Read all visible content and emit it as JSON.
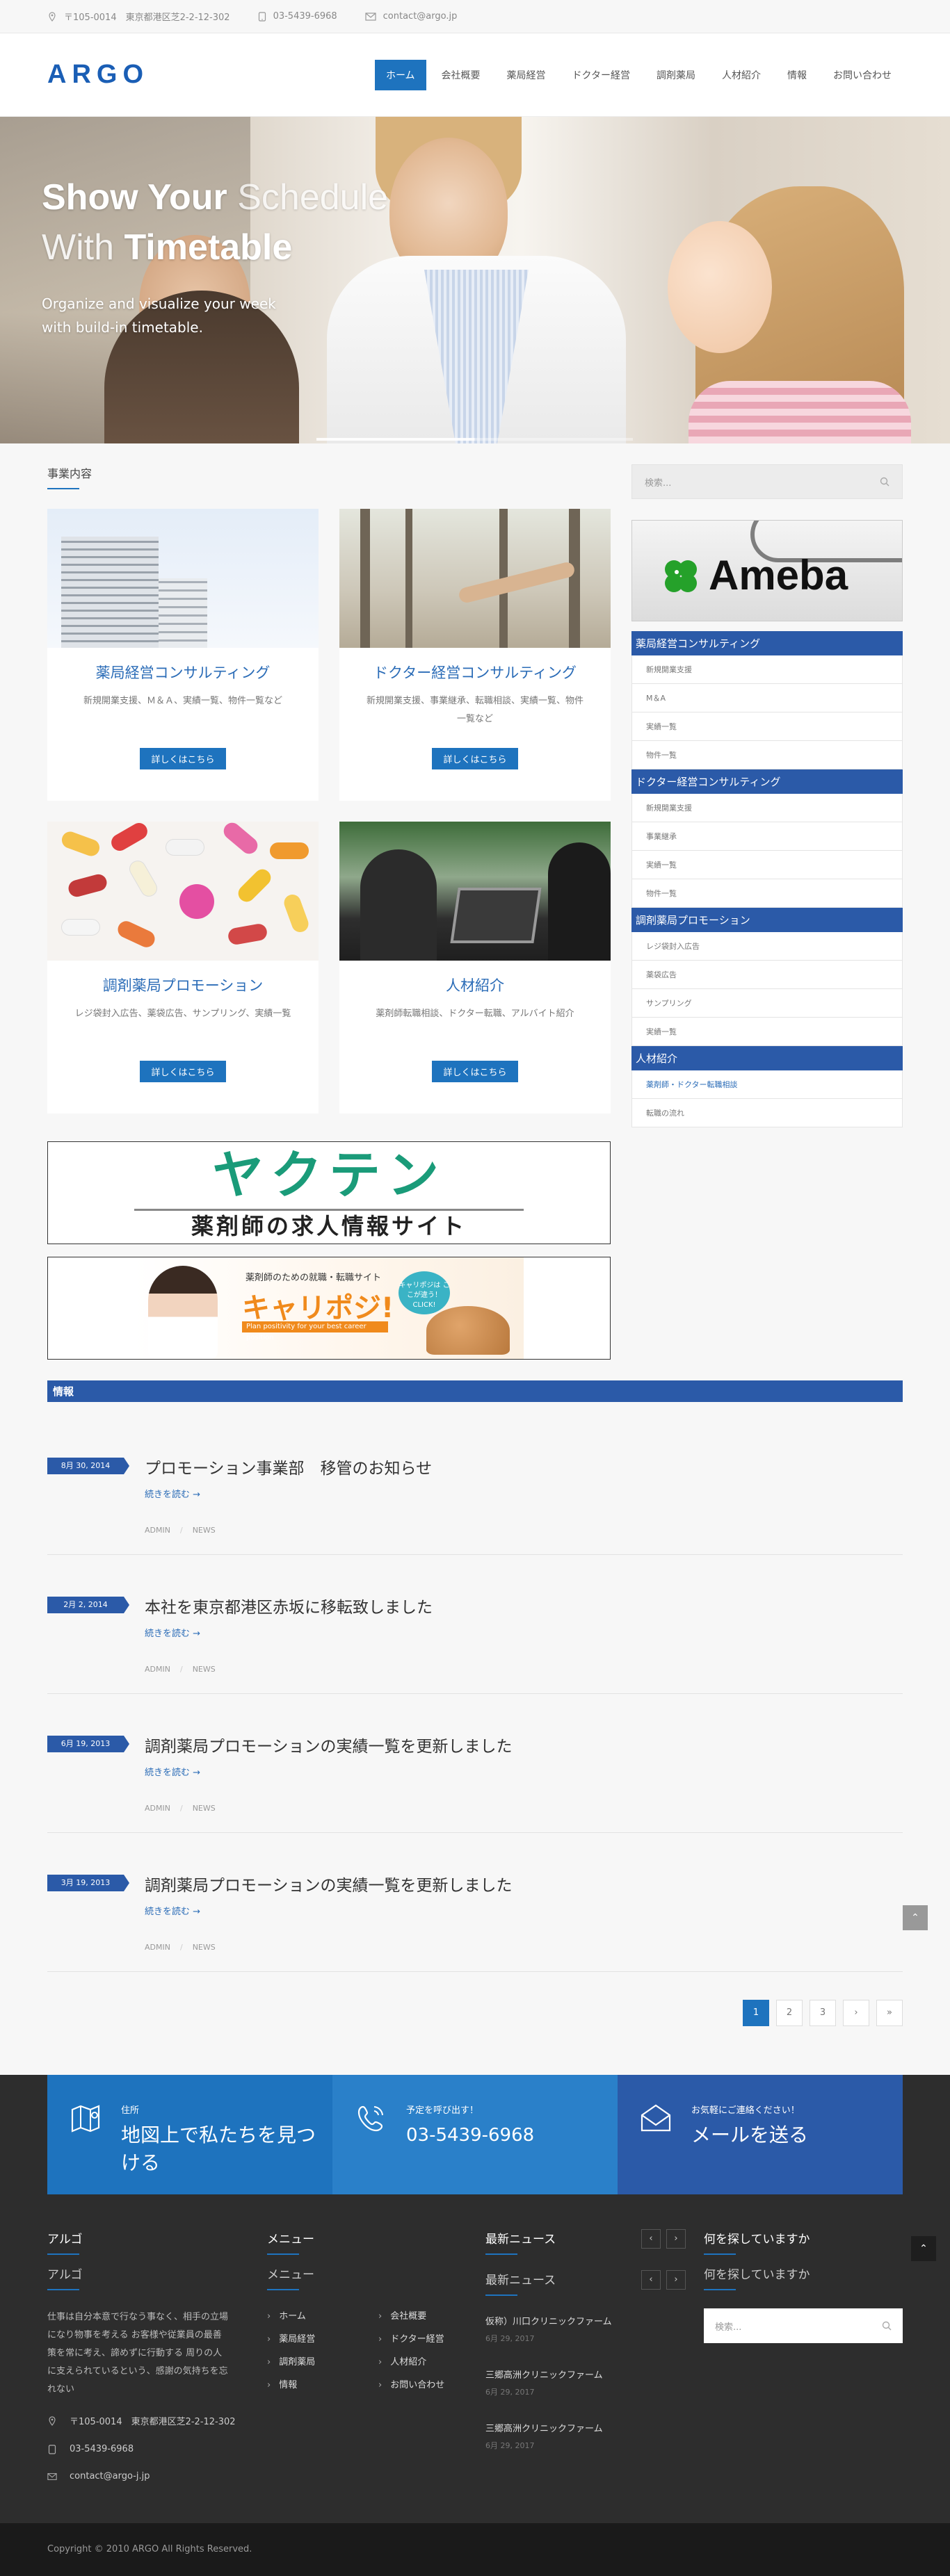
{
  "topbar": {
    "address": "〒105-0014　東京都港区芝2-2-12-302",
    "phone": "03-5439-6968",
    "email": "contact@argo.jp"
  },
  "header": {
    "logo": "ARGO",
    "nav": [
      "ホーム",
      "会社概要",
      "薬局経営",
      "ドクター経営",
      "調剤薬局",
      "人材紹介",
      "情報",
      "お問い合わせ"
    ]
  },
  "hero": {
    "line1_bold": "Show Your",
    "line1_light": " Schedule",
    "line2_light": "With ",
    "line2_bold": "Timetable",
    "sub1": "Organize and visualize your week",
    "sub2": "with build-in timetable.",
    "progress": 0.5
  },
  "business": {
    "title": "事業内容",
    "cards": [
      {
        "title": "薬局経営コンサルティング",
        "desc": "新規開業支援、Ｍ＆Ａ、実績一覧、物件一覧など",
        "button": "詳しくはこちら"
      },
      {
        "title": "ドクター経営コンサルティング",
        "desc": "新規開業支援、事業継承、転職相談、実績一覧、物件一覧など",
        "button": "詳しくはこちら"
      },
      {
        "title": "調剤薬局プロモーション",
        "desc": "レジ袋封入広告、薬袋広告、サンプリング、実績一覧",
        "button": "詳しくはこちら"
      },
      {
        "title": "人材紹介",
        "desc": "薬剤師転職相談、ドクター転職、アルバイト紹介",
        "button": "詳しくはこちら"
      }
    ]
  },
  "banners": {
    "yakuten_big": "ヤクテン",
    "yakuten_small": "薬剤師の求人情報サイト",
    "caripoji_tag": "薬剤師のための就職・転職サイト",
    "caripoji_logo": "キャリポジ!",
    "caripoji_bar": "Plan positivity for your best career position",
    "caripoji_bubble": "キャリポジは ここが違う！ CLICK!"
  },
  "sidebar": {
    "search_placeholder": "検索...",
    "ameba": "Ameba",
    "groups": [
      {
        "title": "薬局経営コンサルティング",
        "items": [
          "新規開業支援",
          "M＆A",
          "実績一覧",
          "物件一覧"
        ]
      },
      {
        "title": "ドクター経営コンサルティング",
        "items": [
          "新規開業支援",
          "事業継承",
          "実績一覧",
          "物件一覧"
        ]
      },
      {
        "title": "調剤薬局プロモーション",
        "items": [
          "レジ袋封入広告",
          "薬袋広告",
          "サンプリング",
          "実績一覧"
        ]
      },
      {
        "title": "人材紹介",
        "items": [
          "薬剤師・ドクター転職相談",
          "転職の流れ"
        ]
      }
    ]
  },
  "info": {
    "title": "情報",
    "read_more": "続きを読む →",
    "posts": [
      {
        "date": "8月 30, 2014",
        "title": "プロモーション事業部　移管のお知らせ",
        "author": "ADMIN",
        "category": "NEWS"
      },
      {
        "date": "2月 2, 2014",
        "title": "本社を東京都港区赤坂に移転致しました",
        "author": "ADMIN",
        "category": "NEWS"
      },
      {
        "date": "6月 19, 2013",
        "title": "調剤薬局プロモーションの実績一覧を更新しました",
        "author": "ADMIN",
        "category": "NEWS"
      },
      {
        "date": "3月 19, 2013",
        "title": "調剤薬局プロモーションの実績一覧を更新しました",
        "author": "ADMIN",
        "category": "NEWS"
      }
    ]
  },
  "pager": [
    "1",
    "2",
    "3",
    "›",
    "»"
  ],
  "cta": {
    "c1_small": "住所",
    "c1_big": "地図上で私たちを見つける",
    "c2_small": "予定を呼び出す！",
    "c2_big": "03-5439-6968",
    "c3_small": "お気軽にご連絡ください！",
    "c3_big": "メールを送る"
  },
  "footer": {
    "about_title": "アルゴ",
    "about_text": "仕事は自分本意で行なう事なく、相手の立場になり物事を考える お客様や従業員の最善策を常に考え、諦めずに行動する 周りの人に支えられているという、感謝の気持ちを忘れない",
    "address": "〒105-0014　東京都港区芝2-2-12-302",
    "phone": "03-5439-6968",
    "email": "contact@argo-j.jp",
    "menu_title": "メニュー",
    "menu": [
      "ホーム",
      "会社概要",
      "薬局経営",
      "ドクター経営",
      "調剤薬局",
      "人材紹介",
      "情報",
      "お問い合わせ"
    ],
    "news_title": "最新ニュース",
    "news": [
      {
        "title": "仮称）川口クリニックファーム",
        "date": "6月 29, 2017"
      },
      {
        "title": "三郷高洲クリニックファーム",
        "date": "6月 29, 2017"
      },
      {
        "title": "三郷高洲クリニックファーム",
        "date": "6月 29, 2017"
      }
    ],
    "search_title": "何を探していますか",
    "search_placeholder": "検索...",
    "copyright": "Copyright © 2010 ARGO All Rights Reserved."
  },
  "colors": {
    "primary": "#1e73be",
    "secondary": "#2b5aa8",
    "dark": "#2d2d2d"
  }
}
